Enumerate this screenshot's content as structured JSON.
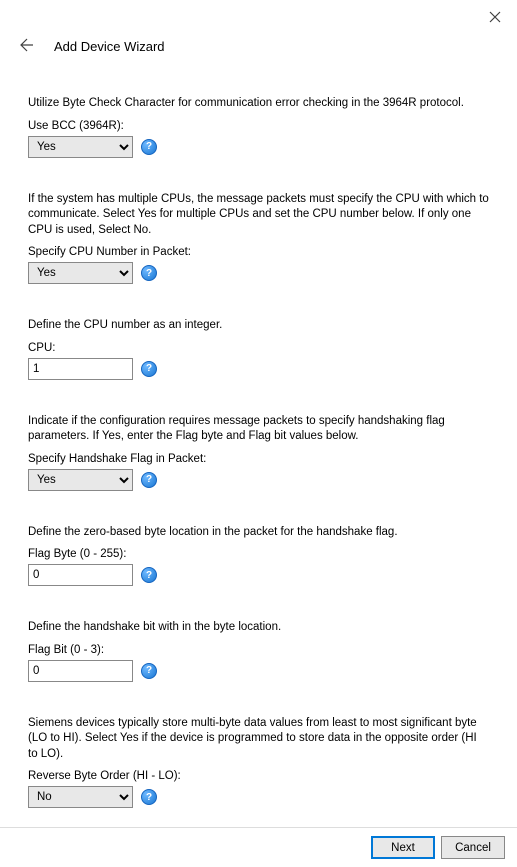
{
  "title": "Add Device Wizard",
  "sections": {
    "bcc": {
      "desc": "Utilize Byte Check Character for communication error checking in the 3964R protocol.",
      "label": "Use BCC (3964R):",
      "value": "Yes",
      "options": [
        "Yes",
        "No"
      ]
    },
    "cpunum": {
      "desc": "If the system has multiple CPUs, the message packets must specify the CPU with which to communicate. Select Yes for multiple CPUs and set the CPU number below. If only one CPU is used, Select No.",
      "label": "Specify CPU Number in Packet:",
      "value": "Yes",
      "options": [
        "Yes",
        "No"
      ]
    },
    "cpu": {
      "desc": "Define the CPU number as an integer.",
      "label": "CPU:",
      "value": "1"
    },
    "hsflag": {
      "desc": "Indicate if the configuration requires message packets to specify handshaking flag parameters. If Yes, enter the Flag byte and Flag bit values below.",
      "label": "Specify Handshake Flag in Packet:",
      "value": "Yes",
      "options": [
        "Yes",
        "No"
      ]
    },
    "flagbyte": {
      "desc": "Define the zero-based byte location in the packet for the handshake flag.",
      "label": "Flag Byte (0 - 255):",
      "value": "0"
    },
    "flagbit": {
      "desc": "Define the handshake bit with in the byte location.",
      "label": "Flag Bit (0 - 3):",
      "value": "0"
    },
    "revbyte": {
      "desc": "Siemens devices typically store multi-byte data values from least to most significant byte (LO to HI). Select Yes if the device is programmed to store data in the opposite order (HI to LO).",
      "label": "Reverse Byte Order (HI - LO):",
      "value": "No",
      "options": [
        "Yes",
        "No"
      ]
    }
  },
  "buttons": {
    "next": "Next",
    "cancel": "Cancel"
  },
  "help_glyph": "?"
}
